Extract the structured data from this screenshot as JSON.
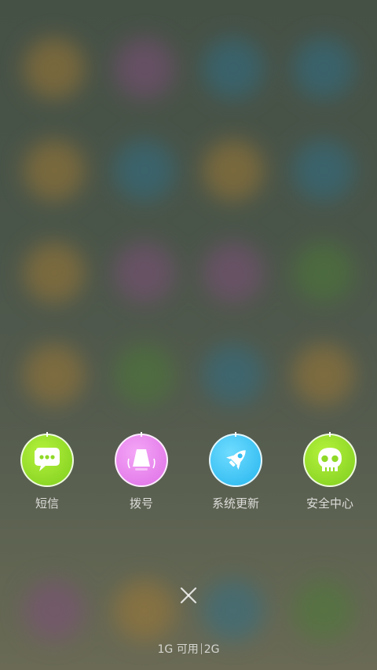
{
  "shortcuts": [
    {
      "label": "短信",
      "icon": "sms-bubble-icon",
      "color": "#8fd926"
    },
    {
      "label": "拨号",
      "icon": "phone-handset-icon",
      "color": "#e77fee"
    },
    {
      "label": "系统更新",
      "icon": "rocket-icon",
      "color": "#33bdf2"
    },
    {
      "label": "安全中心",
      "icon": "skull-shield-icon",
      "color": "#8fd926"
    }
  ],
  "close": {
    "icon": "close-icon"
  },
  "memory": {
    "available": "1G 可用",
    "total": "2G"
  },
  "colors": {
    "background": "#4a5549",
    "label_text": "#ffffff"
  }
}
